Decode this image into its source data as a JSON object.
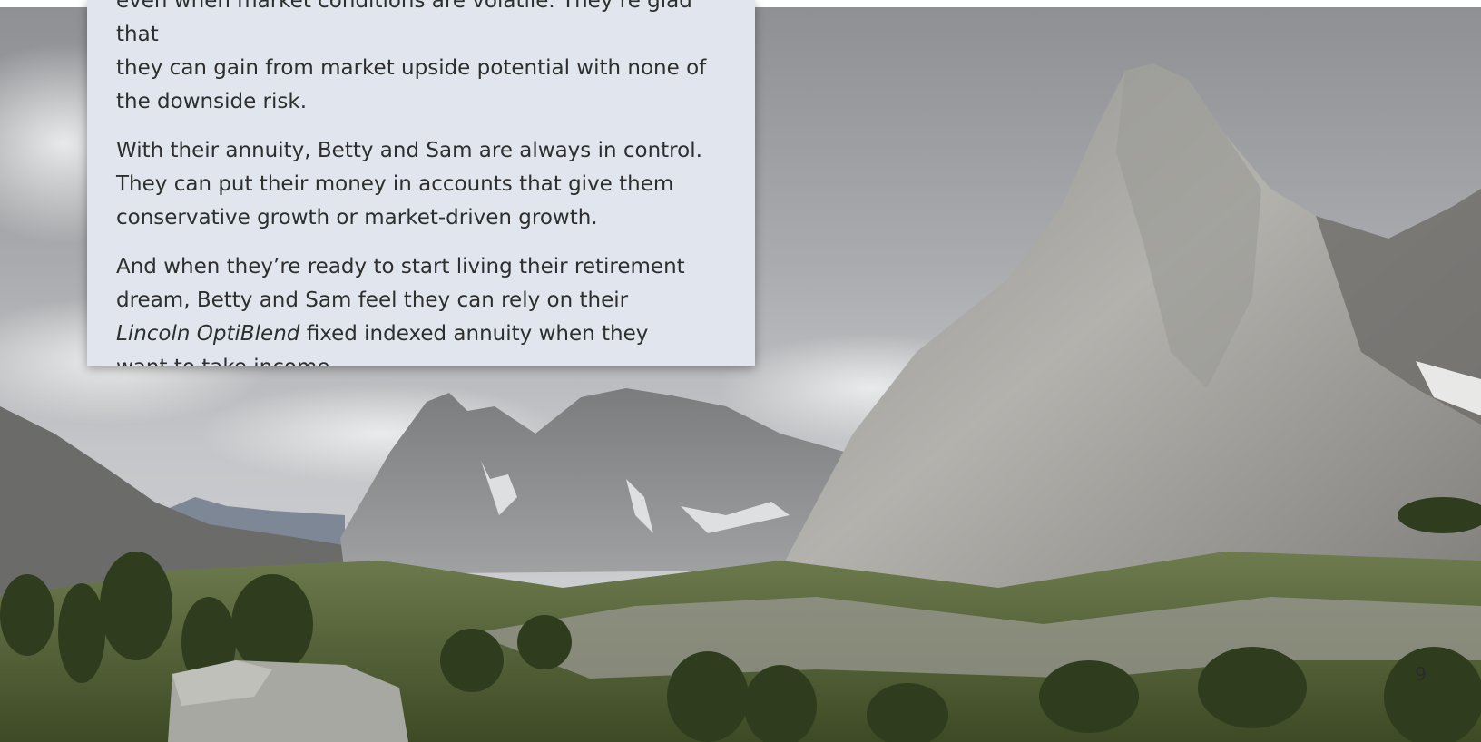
{
  "panel": {
    "p1_line1": "even when market conditions are volatile. They’re glad that",
    "p1_line2": "they can gain from market upside potential with none of",
    "p1_line3": "the downside risk.",
    "p2_line1": "With their annuity, Betty and Sam are always in control.",
    "p2_line2": "They can put their money in accounts that give them",
    "p2_line3": "conservative growth or market-driven growth.",
    "p3_line1": "And when they’re ready to start living their retirement",
    "p3_line2": "dream, Betty and Sam feel they can rely on their",
    "p3_line3_product": "Lincoln OptiBlend",
    "p3_line3_rest": " fixed indexed annuity when they",
    "p3_line4": "want to take income."
  },
  "page_number": "9",
  "colors": {
    "panel_background": "#e1e6ee",
    "body_text": "#2e2e2e"
  }
}
